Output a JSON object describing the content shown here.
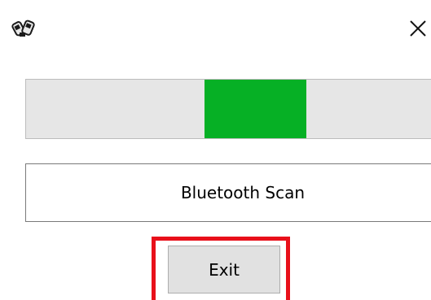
{
  "window": {
    "icon": "bluetooth-devices-icon",
    "close_icon": "close-icon"
  },
  "progress": {
    "state": "marquee",
    "color": "#06b025"
  },
  "scan": {
    "label": "Bluetooth Scan"
  },
  "actions": {
    "exit_label": "Exit",
    "highlight_color": "#e8101a"
  }
}
